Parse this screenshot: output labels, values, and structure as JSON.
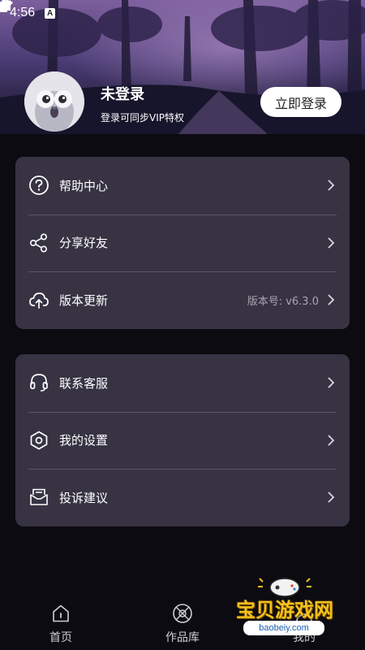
{
  "status_bar": {
    "time": "4:56",
    "notification_icon_letter": "A",
    "icons": [
      "wifi-icon",
      "signal-icon",
      "battery-icon"
    ]
  },
  "profile": {
    "name": "未登录",
    "subtitle": "登录可同步VIP特权",
    "login_button": "立即登录"
  },
  "menu_group_1": [
    {
      "icon": "help-circle-icon",
      "label": "帮助中心",
      "value": ""
    },
    {
      "icon": "share-icon",
      "label": "分享好友",
      "value": ""
    },
    {
      "icon": "cloud-upload-icon",
      "label": "版本更新",
      "value": "版本号: v6.3.0"
    }
  ],
  "menu_group_2": [
    {
      "icon": "headset-icon",
      "label": "联系客服",
      "value": ""
    },
    {
      "icon": "settings-icon",
      "label": "我的设置",
      "value": ""
    },
    {
      "icon": "mail-icon",
      "label": "投诉建议",
      "value": ""
    }
  ],
  "bottom_nav": {
    "home": "首页",
    "library": "作品库",
    "mine": "我的"
  },
  "watermark": {
    "text": "宝贝游戏网",
    "url": "baobeiy.com"
  },
  "colors": {
    "background": "#0c0b11",
    "card": "#373343",
    "divider": "#5b5767",
    "watermark": "#f4c21b"
  }
}
